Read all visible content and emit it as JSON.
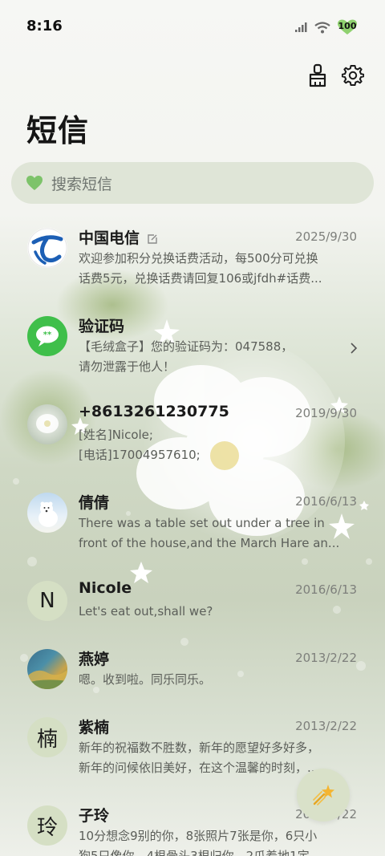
{
  "status_bar": {
    "time": "8:16",
    "battery": "100"
  },
  "title": "短信",
  "search": {
    "placeholder": "搜索短信"
  },
  "conversations": [
    {
      "name": "中国电信",
      "date": "2025/9/30",
      "preview1": "欢迎参加积分兑换话费活动，每500分可兑换",
      "preview2": "话费5元，兑换话费请回复106或jfdh#话费..."
    },
    {
      "name": "验证码",
      "date": "",
      "preview1": "【毛绒盒子】您的验证码为：047588，",
      "preview2": "请勿泄露于他人！"
    },
    {
      "name": "+8613261230775",
      "date": "2019/9/30",
      "preview1": "[姓名]Nicole;",
      "preview2": "[电话]17004957610;"
    },
    {
      "name": "倩倩",
      "date": "2016/6/13",
      "preview1": "There was a table set out under a tree in",
      "preview2": "front of the house,and the March Hare an..."
    },
    {
      "name": "Nicole",
      "avatar_letter": "N",
      "date": "2016/6/13",
      "preview1": "Let's eat out,shall we?",
      "preview2": ""
    },
    {
      "name": "燕婷",
      "date": "2013/2/22",
      "preview1": "嗯。收到啦。同乐同乐。",
      "preview2": ""
    },
    {
      "name": "紫楠",
      "avatar_letter": "楠",
      "date": "2013/2/22",
      "preview1": "新年的祝福数不胜数，新年的愿望好多好多，",
      "preview2": "新年的问候依旧美好，在这个温馨的时刻，..."
    },
    {
      "name": "子玲",
      "avatar_letter": "玲",
      "date": "2013/2/22",
      "preview1": "10分想念9别的你，8张照片7张是你，6只小",
      "preview2": "狗5只像你，4根骨头3根归你，2爪着地1定"
    }
  ],
  "colors": {
    "accent": "#7dc36a",
    "avatar_letter_bg": "#d5dfc4",
    "search_bg": "#dfe5d7"
  }
}
